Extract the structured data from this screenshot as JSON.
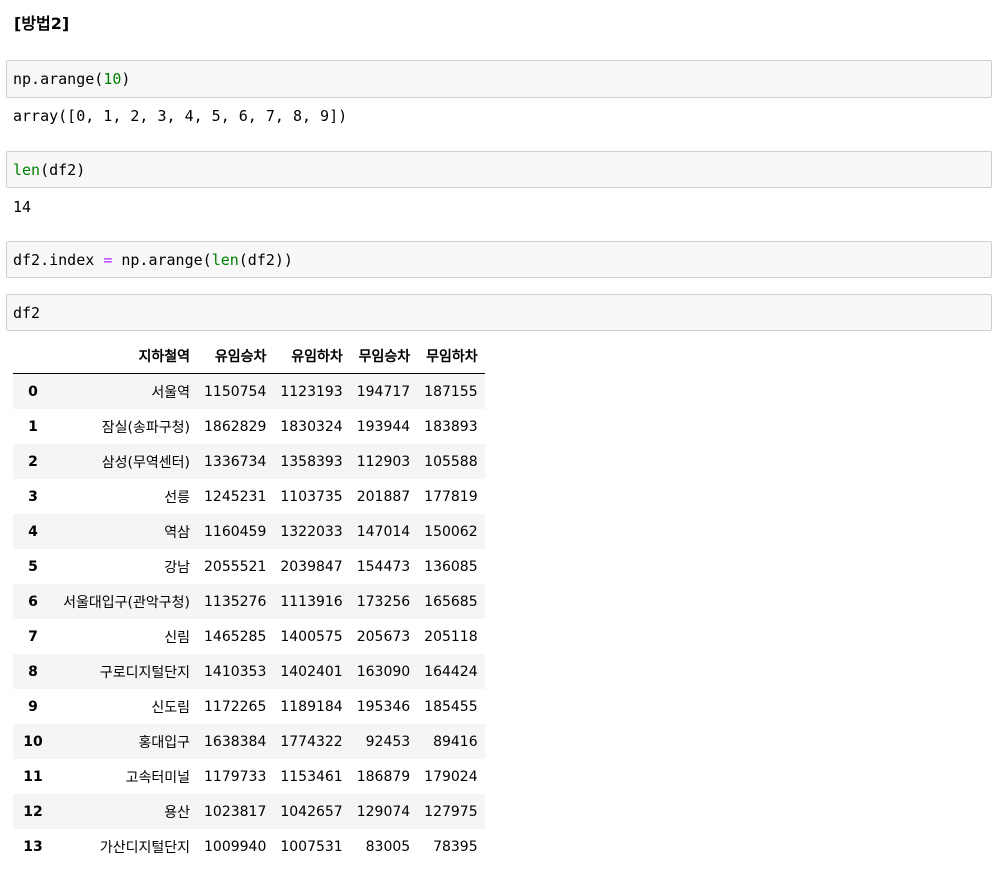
{
  "heading": "[방법2]",
  "cells": [
    {
      "parts": [
        {
          "t": "np.arange(",
          "c": ""
        },
        {
          "t": "10",
          "c": "num"
        },
        {
          "t": ")",
          "c": ""
        }
      ]
    },
    {
      "parts": [
        {
          "t": "len",
          "c": "builtin"
        },
        {
          "t": "(df2)",
          "c": ""
        }
      ]
    },
    {
      "parts": [
        {
          "t": "df2.index ",
          "c": ""
        },
        {
          "t": "=",
          "c": "op"
        },
        {
          "t": " np.arange(",
          "c": ""
        },
        {
          "t": "len",
          "c": "builtin"
        },
        {
          "t": "(df2))",
          "c": ""
        }
      ]
    },
    {
      "parts": [
        {
          "t": "df2",
          "c": ""
        }
      ]
    }
  ],
  "outputs": {
    "arange": "array([0, 1, 2, 3, 4, 5, 6, 7, 8, 9])",
    "len": "14"
  },
  "table": {
    "columns": [
      "",
      "지하철역",
      "유임승차",
      "유임하차",
      "무임승차",
      "무임하차"
    ],
    "rows": [
      [
        "0",
        "서울역",
        "1150754",
        "1123193",
        "194717",
        "187155"
      ],
      [
        "1",
        "잠실(송파구청)",
        "1862829",
        "1830324",
        "193944",
        "183893"
      ],
      [
        "2",
        "삼성(무역센터)",
        "1336734",
        "1358393",
        "112903",
        "105588"
      ],
      [
        "3",
        "선릉",
        "1245231",
        "1103735",
        "201887",
        "177819"
      ],
      [
        "4",
        "역삼",
        "1160459",
        "1322033",
        "147014",
        "150062"
      ],
      [
        "5",
        "강남",
        "2055521",
        "2039847",
        "154473",
        "136085"
      ],
      [
        "6",
        "서울대입구(관악구청)",
        "1135276",
        "1113916",
        "173256",
        "165685"
      ],
      [
        "7",
        "신림",
        "1465285",
        "1400575",
        "205673",
        "205118"
      ],
      [
        "8",
        "구로디지털단지",
        "1410353",
        "1402401",
        "163090",
        "164424"
      ],
      [
        "9",
        "신도림",
        "1172265",
        "1189184",
        "195346",
        "185455"
      ],
      [
        "10",
        "홍대입구",
        "1638384",
        "1774322",
        "92453",
        "89416"
      ],
      [
        "11",
        "고속터미널",
        "1179733",
        "1153461",
        "186879",
        "179024"
      ],
      [
        "12",
        "용산",
        "1023817",
        "1042657",
        "129074",
        "127975"
      ],
      [
        "13",
        "가산디지털단지",
        "1009940",
        "1007531",
        "83005",
        "78395"
      ]
    ]
  }
}
